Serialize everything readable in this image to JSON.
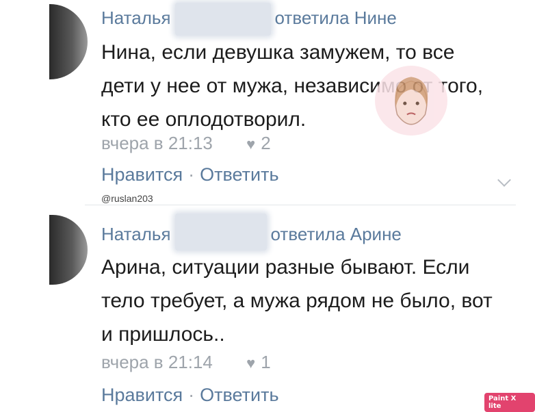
{
  "comments": [
    {
      "author": "Наталья",
      "reply_to": "ответила Нине",
      "text": "Нина, если девушка замужем, то все дети у нее от мужа, независимо от того, кто ее оплодотворил.",
      "time": "вчера в 21:13",
      "likes": "2",
      "like_label": "Нравится",
      "reply_label": "Ответить"
    },
    {
      "author": "Наталья",
      "reply_to": "ответила Арине",
      "text": "Арина, ситуации разные бывают. Если тело требует, а мужа рядом не было, вот и пришлось..",
      "time": "вчера в 21:14",
      "likes": "1",
      "like_label": "Нравится",
      "reply_label": "Ответить"
    }
  ],
  "watermark": "@ruslan203",
  "badge": "Paint X lite",
  "separator": "·"
}
